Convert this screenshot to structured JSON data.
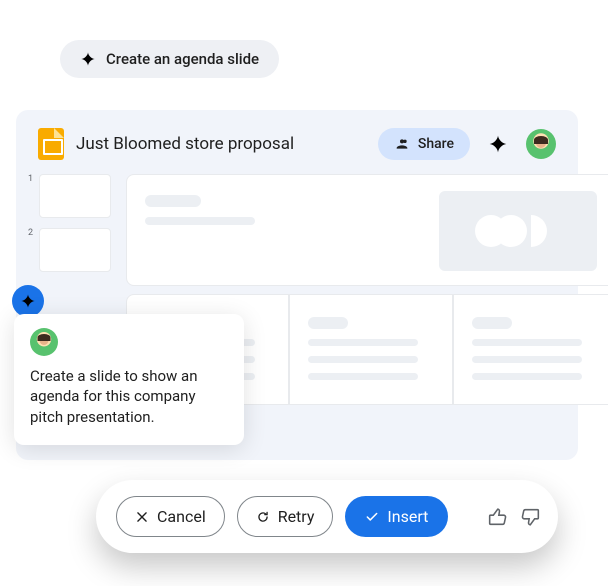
{
  "suggestion_pill": {
    "label": "Create an agenda slide"
  },
  "document": {
    "title": "Just Bloomed store proposal"
  },
  "toolbar": {
    "share_label": "Share"
  },
  "thumbnails": [
    {
      "index": "1"
    },
    {
      "index": "2"
    }
  ],
  "prompt": {
    "text": "Create a slide to show an agenda for this company pitch presentation."
  },
  "actions": {
    "cancel": "Cancel",
    "retry": "Retry",
    "insert": "Insert"
  }
}
